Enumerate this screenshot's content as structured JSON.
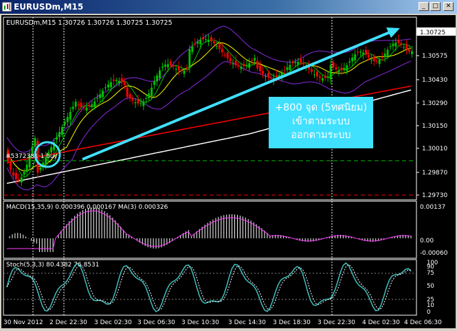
{
  "window": {
    "title": "EURUSDm,M15",
    "buttons": {
      "minimize": "_",
      "maximize": "□",
      "close": "✕"
    }
  },
  "chart": {
    "header": "EURUSDm,M15  1.30726 1.30726 1.30725 1.30725",
    "current_price": "1.30725",
    "price_axis": [
      "1.30725",
      "1.30575",
      "1.30430",
      "1.30290",
      "1.30150",
      "1.30010",
      "1.29870",
      "1.29730"
    ],
    "order_label": "#5372381 1 buy",
    "annotation": {
      "line1": "+800 จุด (5ทศนิยม)",
      "line2": "เข้าตามระบบ",
      "line3": "ออกตามระบบ"
    },
    "time_axis": [
      "30 Nov 2012",
      "2 Dec 22:30",
      "3 Dec 02:30",
      "3 Dec 06:30",
      "3 Dec 10:30",
      "3 Dec 14:30",
      "3 Dec 18:30",
      "3 Dec 22:30",
      "4 Dec 02:30",
      "4 Dec 06:30"
    ],
    "colors": {
      "bull_candle": "#00c000",
      "bear_candle": "#ff0000",
      "bollinger": "#8a2be2",
      "ma_fast": "#ffff00",
      "ma_slow": "#ff0000",
      "ma_long": "#ffffff",
      "annotation_box": "#40e0ff",
      "arrow": "#40e0ff"
    }
  },
  "macd": {
    "header": "MACD(15,35,9) 0.000396 0.000167 MA(3) 0.000326",
    "axis": [
      "0.00137",
      "0.00",
      "-0.00060"
    ]
  },
  "stoch": {
    "header": "Stoch(5,3,3) 80.4382 76.8531",
    "axis": [
      "100",
      "90",
      "75",
      "50",
      "25",
      "10",
      "0"
    ]
  }
}
